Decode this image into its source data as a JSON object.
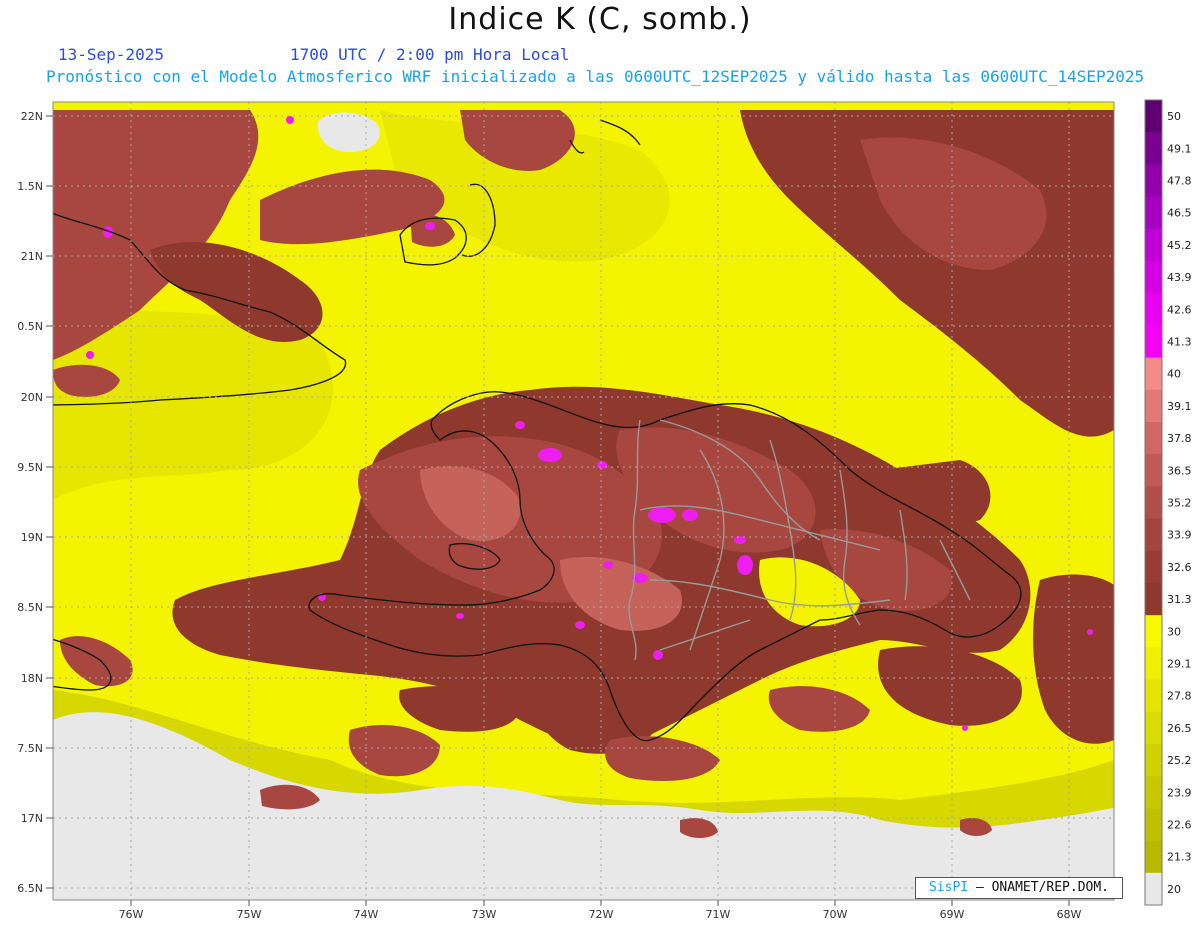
{
  "header": {
    "title": "Indice K (C, somb.)",
    "date": "13-Sep-2025",
    "time": "1700 UTC / 2:00 pm Hora Local",
    "forecast_line": "Pronóstico con el Modelo Atmosferico WRF inicializado a las 0600UTC_12SEP2025 y válido hasta las  0600UTC_14SEP2025"
  },
  "axes": {
    "lat_labels": [
      "22N",
      "1.5N",
      "21N",
      "0.5N",
      "20N",
      "9.5N",
      "19N",
      "8.5N",
      "18N",
      "7.5N",
      "17N",
      "6.5N"
    ],
    "lon_labels": [
      "76W",
      "75W",
      "74W",
      "73W",
      "72W",
      "71W",
      "70W",
      "69W",
      "68W"
    ]
  },
  "colorbar": {
    "levels": [
      "50",
      "49.1",
      "47.8",
      "46.5",
      "45.2",
      "43.9",
      "42.6",
      "41.3",
      "40",
      "39.1",
      "37.8",
      "36.5",
      "35.2",
      "33.9",
      "32.6",
      "31.3",
      "30",
      "29.1",
      "27.8",
      "26.5",
      "25.2",
      "23.9",
      "22.6",
      "21.3",
      "20"
    ],
    "colors": [
      "#5e0070",
      "#7a0090",
      "#9200aa",
      "#a800c0",
      "#bf00d4",
      "#d300e3",
      "#e600ef",
      "#f500f7",
      "#f48a8a",
      "#e27878",
      "#d06666",
      "#c05a55",
      "#b04e48",
      "#a3453e",
      "#983d35",
      "#8e382e",
      "#f8f800",
      "#eef000",
      "#e4e600",
      "#d9dc00",
      "#d0d200",
      "#c8c800",
      "#c0c000",
      "#b8b800",
      "#e8e8e8"
    ]
  },
  "credit": {
    "brand": "SisPI",
    "org": "– ONAMET/REP.DOM."
  },
  "colors": {
    "land_dark": "#8e382e",
    "land_mid": "#a8473f",
    "land_light": "#c5635a",
    "sea_yellow": "#f4f400",
    "sea_olive": "#d6d800",
    "nodata": "#e8e8e8",
    "magenta": "#ee1ef0"
  }
}
